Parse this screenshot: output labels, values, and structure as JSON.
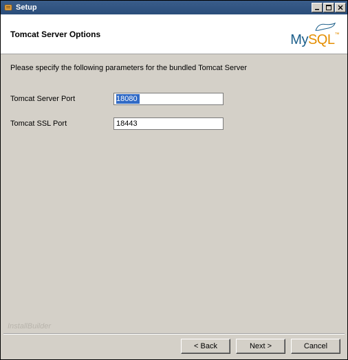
{
  "window": {
    "title": "Setup"
  },
  "header": {
    "title": "Tomcat Server Options",
    "logo_my": "My",
    "logo_sql": "SQL",
    "logo_tm": "™"
  },
  "content": {
    "instruction": "Please specify the following parameters for the bundled Tomcat Server",
    "fields": [
      {
        "label": "Tomcat Server Port",
        "value": "18080",
        "selected": true
      },
      {
        "label": "Tomcat SSL Port",
        "value": "18443",
        "selected": false
      }
    ]
  },
  "footer": {
    "brand": "InstallBuilder",
    "buttons": {
      "back": "< Back",
      "next": "Next >",
      "cancel": "Cancel"
    }
  }
}
